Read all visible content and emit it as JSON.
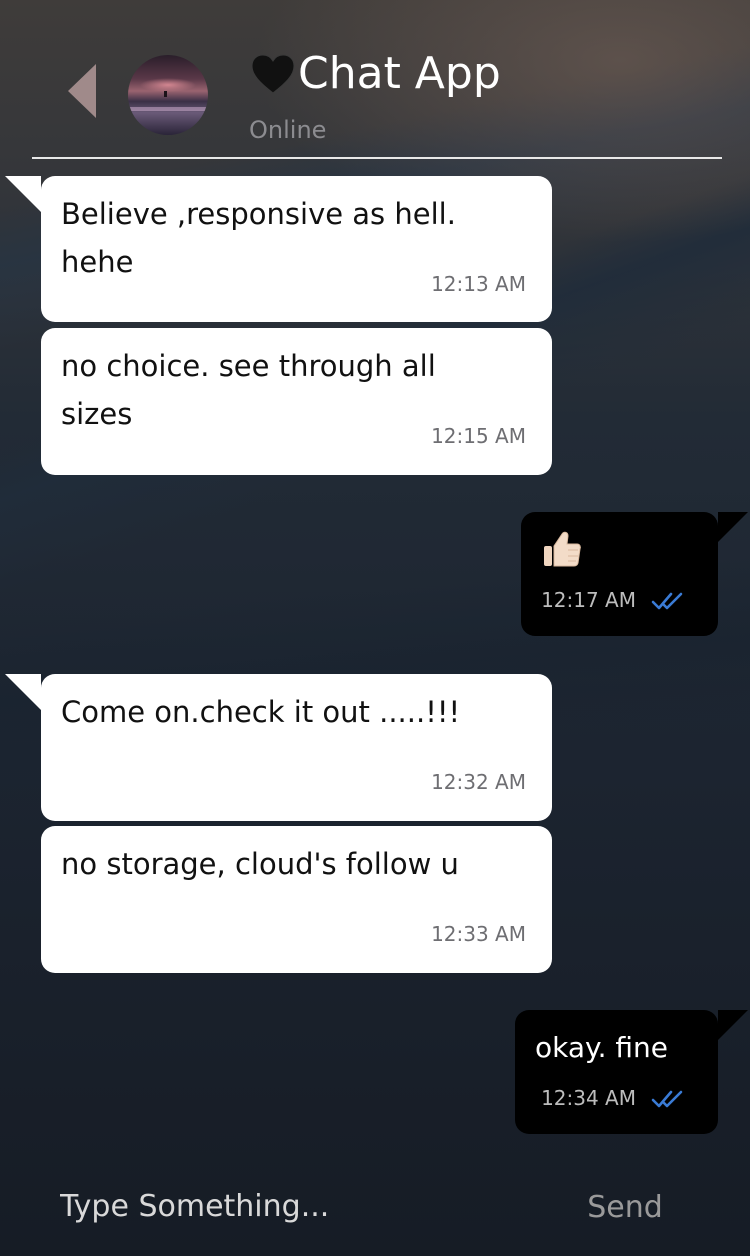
{
  "header": {
    "title": "Chat App",
    "title_icon": "black-heart-icon",
    "status": "Online",
    "back_icon": "chevron-left-icon"
  },
  "messages": [
    {
      "direction": "incoming",
      "text": "Believe ,responsive as hell.\nhehe",
      "time": "12:13 AM"
    },
    {
      "direction": "incoming",
      "text": "no choice. see through all\nsizes",
      "time": "12:15 AM"
    },
    {
      "direction": "outgoing",
      "text": "👍🏻",
      "icon": "thumbs-up-icon",
      "time": "12:17 AM",
      "read_icon": "double-check-icon"
    },
    {
      "direction": "incoming",
      "text": "Come on.check it out .....!!!",
      "time": "12:32 AM"
    },
    {
      "direction": "incoming",
      "text": "no storage, cloud's follow u",
      "time": "12:33 AM"
    },
    {
      "direction": "outgoing",
      "text": "okay. fine",
      "time": "12:34 AM",
      "read_icon": "double-check-icon"
    }
  ],
  "composer": {
    "placeholder": "Type Something...",
    "send_label": "Send"
  },
  "colors": {
    "incoming_bubble": "#ffffff",
    "outgoing_bubble": "#000000",
    "read_receipt": "#3a7bd5",
    "divider": "#e8e8e8"
  }
}
